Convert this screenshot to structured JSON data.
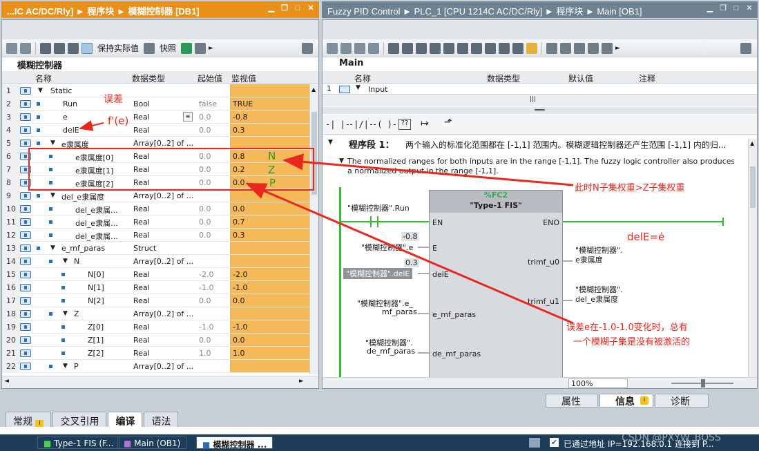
{
  "left_title": "...IC AC/DC/Rly] ► 程序块 ► 模糊控制器 [DB1]",
  "right_title": "Fuzzy PID Control ► PLC_1 [CPU 1214C AC/DC/Rly] ► 程序块 ► Main [OB1]",
  "left_toolbar": {
    "keep_actual": "保持实际值",
    "snapshot": "快照"
  },
  "left_panel_title": "模糊控制器",
  "left_headers": {
    "name": "名称",
    "type": "数据类型",
    "start": "起始值",
    "monitor": "监视值"
  },
  "rows": [
    {
      "n": "1",
      "name": "Static",
      "type": "",
      "start": "",
      "mon": "",
      "lvl": 0,
      "tri": "▼",
      "bul": false
    },
    {
      "n": "2",
      "name": "Run",
      "type": "Bool",
      "start": "false",
      "mon": "TRUE",
      "lvl": 1,
      "tri": "",
      "bul": true
    },
    {
      "n": "3",
      "name": "e",
      "type": "Real",
      "start": "0.0",
      "mon": "-0.8",
      "lvl": 1,
      "tri": "",
      "bul": true
    },
    {
      "n": "4",
      "name": "delE",
      "type": "Real",
      "start": "0.0",
      "mon": "0.3",
      "lvl": 1,
      "tri": "",
      "bul": true
    },
    {
      "n": "5",
      "name": "e隶属度",
      "type": "Array[0..2] of ...",
      "start": "",
      "mon": "",
      "lvl": 1,
      "tri": "▼",
      "bul": true
    },
    {
      "n": "6",
      "name": "e隶属度[0]",
      "type": "Real",
      "start": "0.0",
      "mon": "0.8",
      "lvl": 2,
      "tri": "",
      "bul": true
    },
    {
      "n": "7",
      "name": "e隶属度[1]",
      "type": "Real",
      "start": "0.0",
      "mon": "0.2",
      "lvl": 2,
      "tri": "",
      "bul": true
    },
    {
      "n": "8",
      "name": "e隶属度[2]",
      "type": "Real",
      "start": "0.0",
      "mon": "0.0",
      "lvl": 2,
      "tri": "",
      "bul": true
    },
    {
      "n": "9",
      "name": "del_e隶属度",
      "type": "Array[0..2] of ...",
      "start": "",
      "mon": "",
      "lvl": 1,
      "tri": "▼",
      "bul": true
    },
    {
      "n": "10",
      "name": "del_e隶属...",
      "type": "Real",
      "start": "0.0",
      "mon": "0.0",
      "lvl": 2,
      "tri": "",
      "bul": true
    },
    {
      "n": "11",
      "name": "del_e隶属...",
      "type": "Real",
      "start": "0.0",
      "mon": "0.7",
      "lvl": 2,
      "tri": "",
      "bul": true
    },
    {
      "n": "12",
      "name": "del_e隶属...",
      "type": "Real",
      "start": "0.0",
      "mon": "0.3",
      "lvl": 2,
      "tri": "",
      "bul": true
    },
    {
      "n": "13",
      "name": "e_mf_paras",
      "type": "Struct",
      "start": "",
      "mon": "",
      "lvl": 1,
      "tri": "▼",
      "bul": true
    },
    {
      "n": "14",
      "name": "N",
      "type": "Array[0..2] of ...",
      "start": "",
      "mon": "",
      "lvl": 2,
      "tri": "▼",
      "bul": true
    },
    {
      "n": "15",
      "name": "N[0]",
      "type": "Real",
      "start": "-2.0",
      "mon": "-2.0",
      "lvl": 3,
      "tri": "",
      "bul": true
    },
    {
      "n": "16",
      "name": "N[1]",
      "type": "Real",
      "start": "-1.0",
      "mon": "-1.0",
      "lvl": 3,
      "tri": "",
      "bul": true
    },
    {
      "n": "17",
      "name": "N[2]",
      "type": "Real",
      "start": "0.0",
      "mon": "0.0",
      "lvl": 3,
      "tri": "",
      "bul": true
    },
    {
      "n": "18",
      "name": "Z",
      "type": "Array[0..2] of ...",
      "start": "",
      "mon": "",
      "lvl": 2,
      "tri": "▼",
      "bul": true
    },
    {
      "n": "19",
      "name": "Z[0]",
      "type": "Real",
      "start": "-1.0",
      "mon": "-1.0",
      "lvl": 3,
      "tri": "",
      "bul": true
    },
    {
      "n": "20",
      "name": "Z[1]",
      "type": "Real",
      "start": "0.0",
      "mon": "0.0",
      "lvl": 3,
      "tri": "",
      "bul": true
    },
    {
      "n": "21",
      "name": "Z[2]",
      "type": "Real",
      "start": "1.0",
      "mon": "1.0",
      "lvl": 3,
      "tri": "",
      "bul": true
    },
    {
      "n": "22",
      "name": "P",
      "type": "Array[0..2] of ...",
      "start": "",
      "mon": "",
      "lvl": 2,
      "tri": "▼",
      "bul": true
    }
  ],
  "right_panel_title": "Main",
  "right_headers": {
    "name": "名称",
    "type": "数据类型",
    "default": "默认值",
    "comment": "注释"
  },
  "right_row": {
    "n": "1",
    "name": "Input"
  },
  "segment": {
    "label": "程序段 1：",
    "title": "两个输入的标准化范围都在 [-1,1] 范围内。模糊逻辑控制器还产生范围 [-1,1] 内的归...",
    "comment1": "The normalized ranges for both inputs are in the range [-1,1]. The fuzzy logic controller also produces",
    "comment2": "a normalized output in the range [-1,1]."
  },
  "fbd": {
    "block_id": "%FC2",
    "block_name": "\"Type-1 FIS\"",
    "pin_en": "EN",
    "pin_eno": "ENO",
    "pin_e": "E",
    "pin_dele": "delE",
    "pin_emf": "e_mf_paras",
    "pin_demf": "de_mf_paras",
    "pin_u0": "trimf_u0",
    "pin_u1": "trimf_u1",
    "in_run": "\"模糊控制器\".Run",
    "val_e": "-0.8",
    "in_e": "\"模糊控制器\".e",
    "val_dele": "0.3",
    "in_dele": "\"模糊控制器\".delE",
    "in_emf1": "\"模糊控制器\".e_",
    "in_emf2": "mf_paras",
    "in_demf1": "\"模糊控制器\".",
    "in_demf2": "de_mf_paras",
    "out_u0_1": "\"模糊控制器\".",
    "out_u0_2": "e隶属度",
    "out_u1_1": "\"模糊控制器\".",
    "out_u1_2": "del_e隶属度"
  },
  "zoom": "100%",
  "annotations": {
    "err": "误差",
    "fe": "f'(e)",
    "n": "N",
    "z": "Z",
    "p": "P",
    "weights": "此时N子集权重>Z子集权重",
    "dele": "delE=ė",
    "note1": "误差e在-1.0-1.0变化时，总有",
    "note2": "一个模糊子集是没有被激活的"
  },
  "inspector_tabs": {
    "props": "属性",
    "info": "信息",
    "diag": "诊断"
  },
  "bottom_tabs": [
    "常规",
    "交叉引用",
    "编译",
    "语法"
  ],
  "taskbar": {
    "t1": "Type-1 FIS (F...",
    "t2": "Main (OB1)",
    "t3": "模糊控制器 ...",
    "status": "已通过地址 IP=192.168.0.1 连接到 P...",
    "watermark": "CSDN @PXYW_BOSS"
  },
  "colors": {
    "accent": "#e8901a",
    "monitor": "#f6b95a",
    "annotation": "#e8271f",
    "green": "#2f9a2f"
  }
}
